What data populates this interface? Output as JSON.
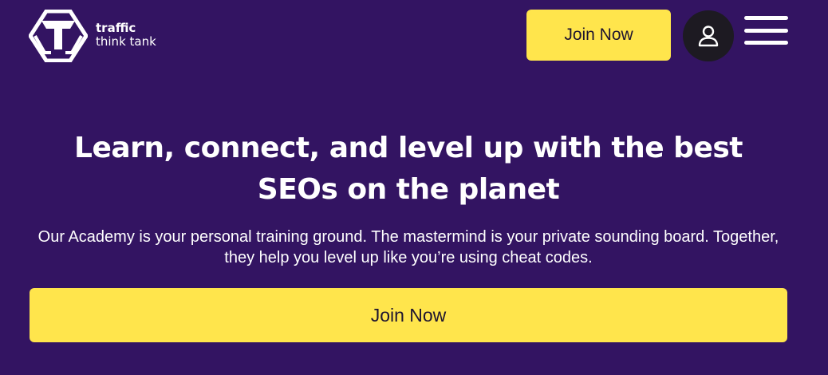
{
  "header": {
    "logo": {
      "line1": "traffic",
      "line2": "think tank",
      "icon": "traffic-think-tank-logo-icon"
    },
    "join_label": "Join Now",
    "user_icon": "user-icon",
    "menu_icon": "hamburger-menu-icon"
  },
  "hero": {
    "headline": "Learn, connect, and level up with the best SEOs on the planet",
    "subtext": "Our Academy is your personal training ground. The mastermind is your private sounding board. Together, they help you level up like you’re using cheat codes.",
    "join_label": "Join Now"
  },
  "colors": {
    "background": "#331462",
    "accent": "#ffe54c",
    "button_text": "#1f1530",
    "user_button_bg": "#1d1a22",
    "text": "#ffffff"
  }
}
